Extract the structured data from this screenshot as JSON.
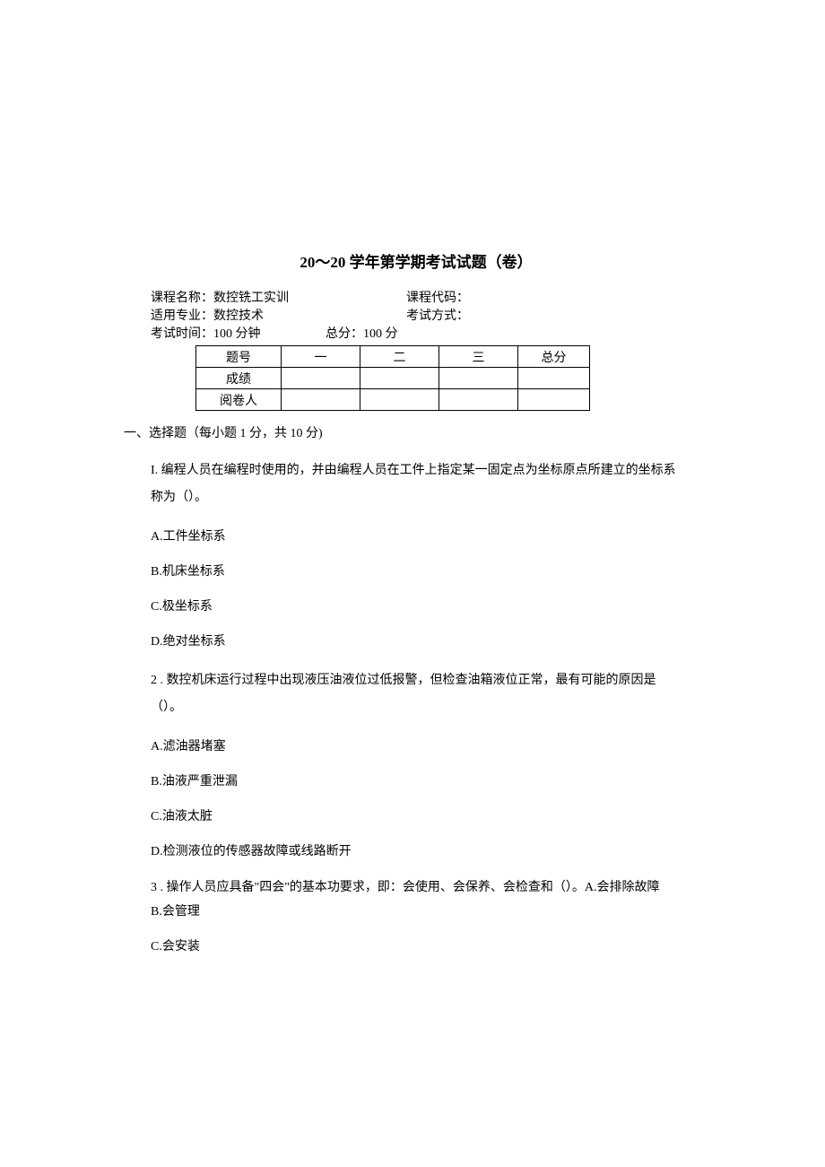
{
  "title": "20～20 学年第学期考试试题（卷）",
  "header": {
    "courseName": "课程名称：数控铣工实训",
    "courseCode": "课程代码：",
    "major": "适用专业：数控技术",
    "examMode": "考试方式：",
    "duration": "考试时间：100 分钟",
    "totalScore": "总分：100 分"
  },
  "scoreTable": {
    "rowLabels": [
      "题号",
      "成绩",
      "阅卷人"
    ],
    "columns": [
      "一",
      "二",
      "三",
      "总分"
    ]
  },
  "sectionTitle": "一、选择题（每小题 1 分，共 10 分)",
  "q1": {
    "text": "I. 编程人员在编程时使用的，并由编程人员在工件上指定某一固定点为坐标原点所建立的坐标系称为（）。",
    "optA": "A.工件坐标系",
    "optB": "B.机床坐标系",
    "optC": "C.极坐标系",
    "optD": "D.绝对坐标系"
  },
  "q2": {
    "text": "2  . 数控机床运行过程中出现液压油液位过低报警，但检查油箱液位正常，最有可能的原因是（）。",
    "optA": "A.滤油器堵塞",
    "optB": "B.油液严重泄漏",
    "optC": "C.油液太脏",
    "optD": "D.检测液位的传感器故障或线路断开"
  },
  "q3": {
    "text": "3  . 操作人员应具备\"四会\"的基本功要求，即：会使用、会保养、会检查和（）。A.会排除故障",
    "optB": "B.会管理",
    "optC": "C.会安装"
  }
}
